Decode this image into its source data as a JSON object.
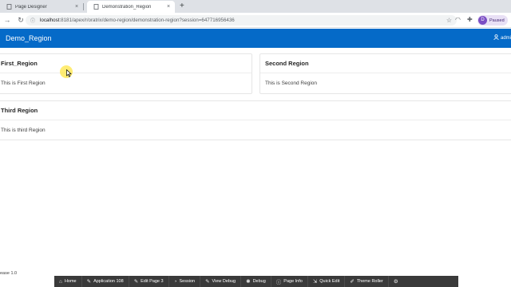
{
  "browser": {
    "tabs": [
      {
        "title": "Page Designer",
        "close": "×"
      },
      {
        "title": "Demonstration_Region",
        "close": "×"
      }
    ],
    "new_tab": "+",
    "url_host": "localhost",
    "url_path": ":8181/apex/r/oratrix/demo-region/demonstration-region?session=647716956436",
    "profile_initial": "D",
    "profile_status": "Paused"
  },
  "app": {
    "title": "Demo_Region",
    "user": "admi"
  },
  "regions": [
    {
      "title": "First_Region",
      "body": "This is First Region"
    },
    {
      "title": "Second Region",
      "body": "This is Second Region"
    },
    {
      "title": "Third Region",
      "body": "This is third Region"
    }
  ],
  "footer": {
    "release": "ease 1.0"
  },
  "dev_toolbar": {
    "items": [
      {
        "label": "Home",
        "icon": "home-icon"
      },
      {
        "label": "Application 108",
        "icon": "edit-icon"
      },
      {
        "label": "Edit Page 3",
        "icon": "edit-icon"
      },
      {
        "label": "Session",
        "icon": "session-icon"
      },
      {
        "label": "View Debug",
        "icon": "edit-icon"
      },
      {
        "label": "Debug",
        "icon": "bug-icon"
      },
      {
        "label": "Page Info",
        "icon": "info-icon"
      },
      {
        "label": "Quick Edit",
        "icon": "quick-edit-icon"
      },
      {
        "label": "Theme Roller",
        "icon": "brush-icon"
      }
    ]
  },
  "colors": {
    "header": "#056ac8",
    "devbar": "#3a3a3a"
  }
}
